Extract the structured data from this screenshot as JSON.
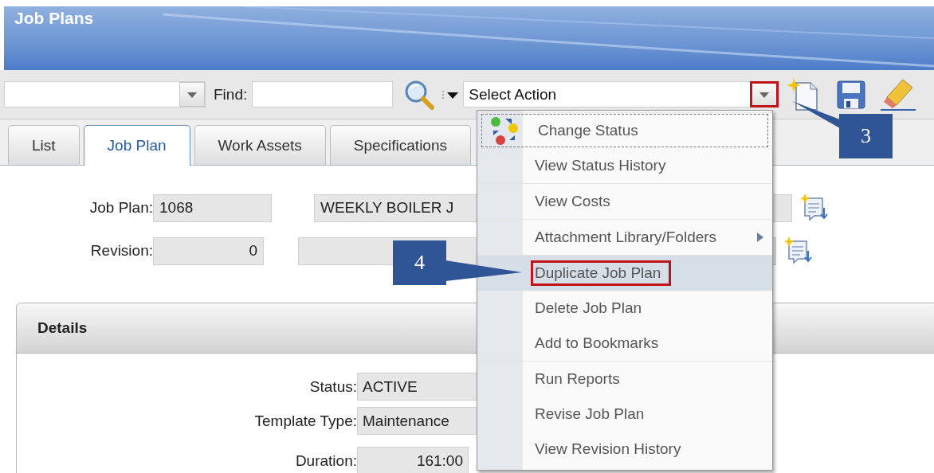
{
  "window": {
    "title": "Job Plans"
  },
  "toolbar": {
    "find_label": "Find:",
    "action_select": {
      "value": "Select Action",
      "button_outlined": true
    }
  },
  "tabs": [
    {
      "label": "List",
      "selected": false
    },
    {
      "label": "Job Plan",
      "selected": true
    },
    {
      "label": "Work Assets",
      "selected": false
    },
    {
      "label": "Specifications",
      "selected": false
    }
  ],
  "header_fields": [
    {
      "label": "Job Plan:",
      "value": "1068",
      "kind": "text",
      "description": "WEEKLY BOILER J"
    },
    {
      "label": "Revision:",
      "value": "0",
      "kind": "number"
    }
  ],
  "details": {
    "title": "Details",
    "fields": [
      {
        "label": "Status:",
        "value": "ACTIVE",
        "kind": "text"
      },
      {
        "label": "Template Type:",
        "value": "Maintenance",
        "kind": "text"
      },
      {
        "label": "Duration:",
        "value": "161:00",
        "kind": "number"
      }
    ]
  },
  "action_menu": {
    "groups": [
      {
        "items": [
          {
            "label": "Change Status",
            "icon": true,
            "focused": true,
            "selected": false,
            "outlined": false,
            "submenu": false
          },
          {
            "label": "View Status History",
            "icon": false,
            "focused": false,
            "selected": false,
            "outlined": false,
            "submenu": false
          }
        ]
      },
      {
        "items": [
          {
            "label": "View Costs",
            "icon": false,
            "focused": false,
            "selected": false,
            "outlined": false,
            "submenu": false
          }
        ]
      },
      {
        "items": [
          {
            "label": "Attachment Library/Folders",
            "icon": false,
            "focused": false,
            "selected": false,
            "outlined": false,
            "submenu": true
          }
        ]
      },
      {
        "items": [
          {
            "label": "Duplicate Job Plan",
            "icon": false,
            "focused": false,
            "selected": true,
            "outlined": true,
            "submenu": false
          },
          {
            "label": "Delete Job Plan",
            "icon": false,
            "focused": false,
            "selected": false,
            "outlined": false,
            "submenu": false
          },
          {
            "label": "Add to Bookmarks",
            "icon": false,
            "focused": false,
            "selected": false,
            "outlined": false,
            "submenu": false
          }
        ]
      },
      {
        "items": [
          {
            "label": "Run Reports",
            "icon": false,
            "focused": false,
            "selected": false,
            "outlined": false,
            "submenu": false
          },
          {
            "label": "Revise Job Plan",
            "icon": false,
            "focused": false,
            "selected": false,
            "outlined": false,
            "submenu": false
          },
          {
            "label": "View Revision History",
            "icon": false,
            "focused": false,
            "selected": false,
            "outlined": false,
            "submenu": false
          }
        ]
      }
    ]
  },
  "callouts": [
    {
      "label": "3",
      "kind": "action_button"
    },
    {
      "label": "4",
      "kind": "menu_item"
    }
  ]
}
